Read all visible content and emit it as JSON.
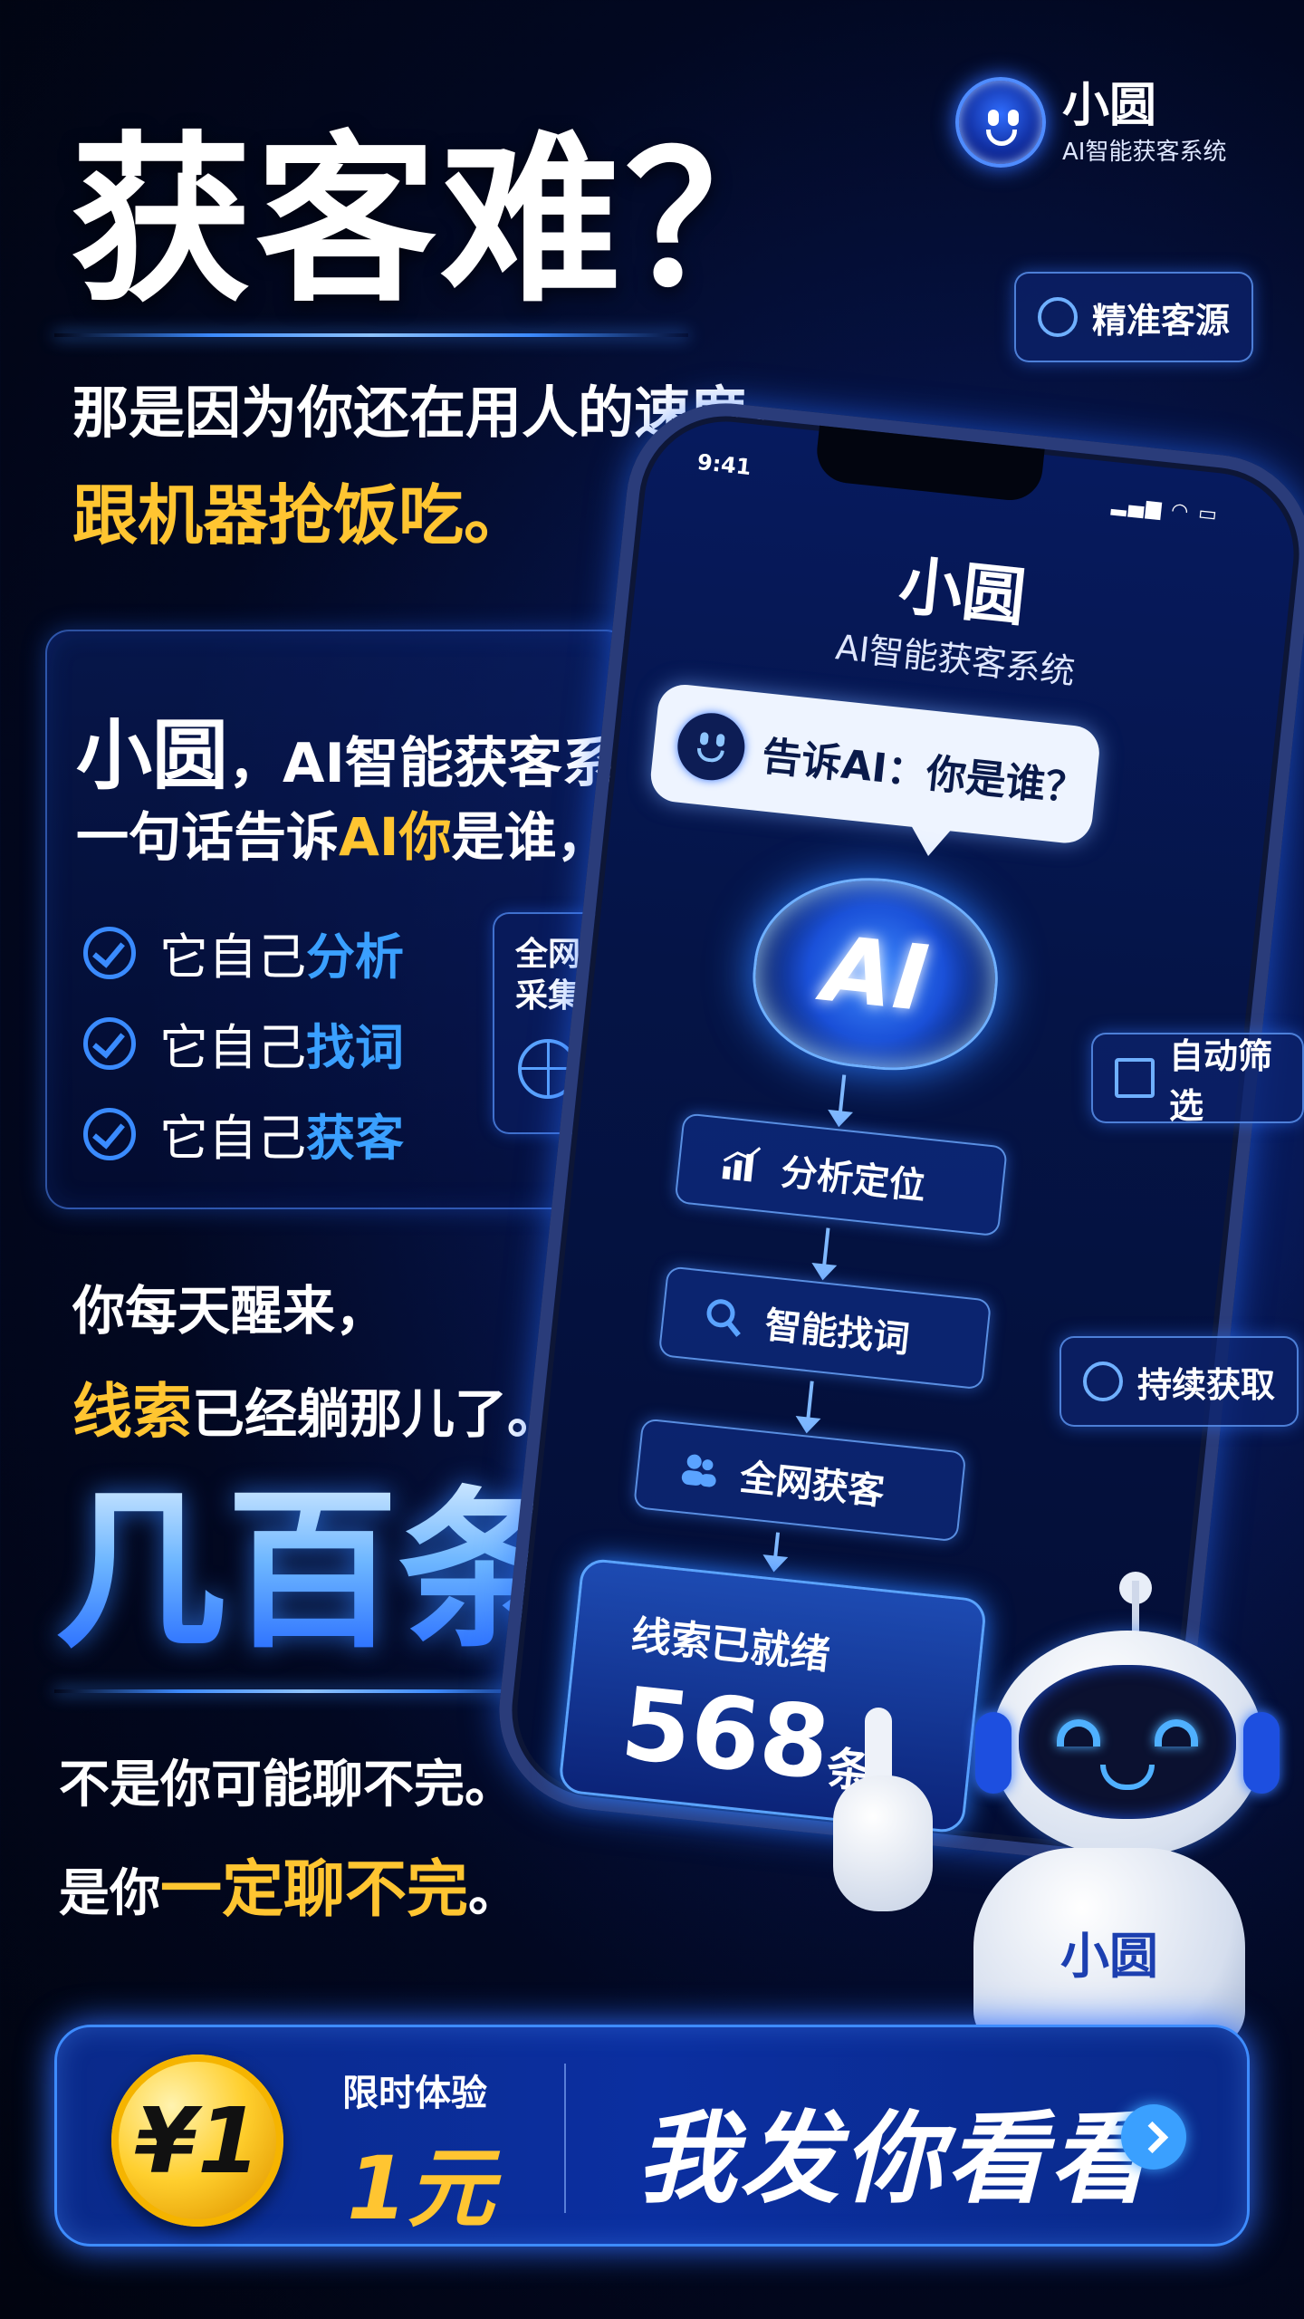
{
  "brand": {
    "name": "小圆",
    "subtitle": "AI智能获客系统"
  },
  "hero": {
    "headline": "获客难？",
    "line1": "那是因为你还在用人的速度，",
    "line2": "跟机器抢饭吃。"
  },
  "card": {
    "title_big": "小圆",
    "title_rest": "，AI智能获客系统",
    "line2_pre": "一句话告诉",
    "line2_highlight": "AI你",
    "line2_post": "是谁，",
    "checks": [
      {
        "pre": "它自己",
        "highlight": "分析"
      },
      {
        "pre": "它自己",
        "highlight": "找词"
      },
      {
        "pre": "它自己",
        "highlight": "获客"
      }
    ],
    "collect_label_1": "全网",
    "collect_label_2": "采集",
    "collect_icon": "globe-search-icon"
  },
  "middle": {
    "line1": "你每天醒来，",
    "line2_highlight": "线索",
    "line2_rest": "已经躺那儿了。",
    "big": "几百条。"
  },
  "bottom": {
    "line1": "不是你可能聊不完。",
    "line2_pre": "是你",
    "line2_highlight": "一定聊不完",
    "line2_post": "。"
  },
  "phone": {
    "time": "9:41",
    "status": "▂▄▆ ◠ ▭",
    "app_title": "小圆",
    "app_subtitle": "AI智能获客系统",
    "bubble_text": "告诉AI：你是谁？",
    "brain_label": "AI",
    "steps": [
      {
        "label": "分析定位",
        "icon": "bar-chart-icon"
      },
      {
        "label": "智能找词",
        "icon": "search-icon"
      },
      {
        "label": "全网获客",
        "icon": "users-icon"
      }
    ],
    "result_label": "线索已就绪",
    "result_count": "568",
    "result_unit": "条"
  },
  "tags": {
    "precise": "精准客源",
    "filter": "自动筛选",
    "continuous": "持续获取"
  },
  "robot": {
    "label": "小圆"
  },
  "cta": {
    "coin": "¥1",
    "small": "限时体验",
    "price": "1元",
    "action": "我发你看看"
  },
  "colors": {
    "accent_yellow": "#ffc531",
    "accent_blue": "#3aa0ff",
    "background": "#020821"
  }
}
